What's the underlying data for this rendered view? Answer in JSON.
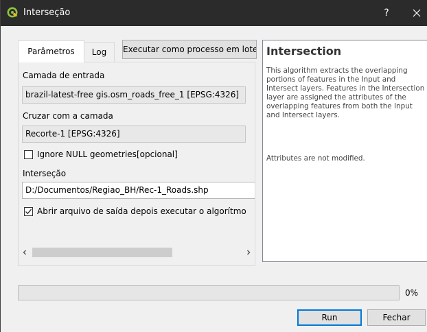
{
  "window": {
    "title": "Interseção",
    "help_label": "?",
    "app_icon": "qgis-logo-icon",
    "close_icon": "close-icon",
    "titlebar_color": "#2b2b2b"
  },
  "tabs": [
    {
      "label": "Parâmetros",
      "active": true
    },
    {
      "label": "Log",
      "active": false
    }
  ],
  "batch_button_label": "Executar como processo em lote",
  "params": {
    "input_layer_label": "Camada de entrada",
    "input_layer_value": "brazil-latest-free gis.osm_roads_free_1 [EPSG:4326]",
    "overlay_layer_label": "Cruzar com a camada",
    "overlay_layer_value": "Recorte-1 [EPSG:4326]",
    "ignore_null_label": "Ignore NULL geometries[opcional]",
    "ignore_null_checked": false,
    "output_label": "Interseção",
    "output_value": "D:/Documentos/Regiao_BH/Rec-1_Roads.shp",
    "open_output_label": "Abrir arquivo de saída depois executar o algorítmo",
    "open_output_checked": true
  },
  "scrollbar": {
    "left_arrow": "chevron-left-icon",
    "right_arrow": "chevron-right-icon"
  },
  "help": {
    "title": "Intersection",
    "paragraph1": "This algorithm extracts the overlapping portions of features in the Input and Intersect layers. Features in the Intersection layer are assigned the attributes of the overlapping features from both the Input and Intersect layers.",
    "paragraph2": "Attributes are not modified."
  },
  "progress": {
    "value": 0,
    "label": "0%",
    "fill_color": "#06b025"
  },
  "buttons": {
    "run_label": "Run",
    "close_label": "Fechar",
    "focus_color": "#0078d7"
  }
}
